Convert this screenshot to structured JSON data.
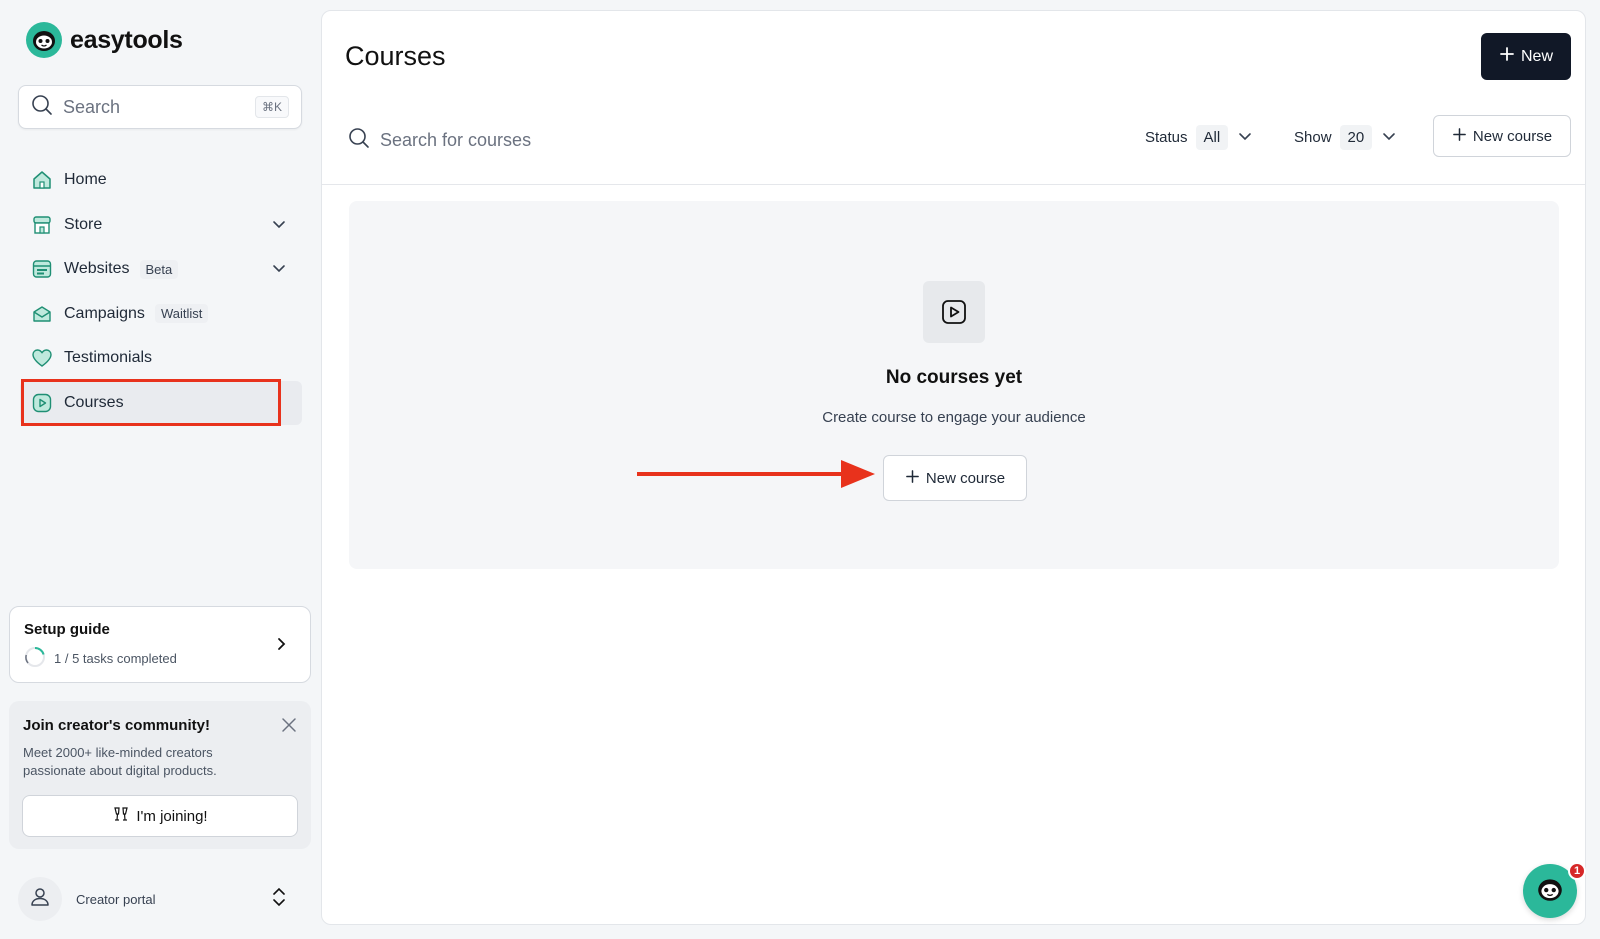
{
  "brand": {
    "name": "easytools"
  },
  "sidebar": {
    "search": {
      "placeholder": "Search",
      "shortcut": "⌘K"
    },
    "items": [
      {
        "label": "Home",
        "icon": "home-icon"
      },
      {
        "label": "Store",
        "icon": "store-icon",
        "expandable": true
      },
      {
        "label": "Websites",
        "icon": "websites-icon",
        "badge": "Beta",
        "expandable": true
      },
      {
        "label": "Campaigns",
        "icon": "campaigns-icon",
        "badge": "Waitlist"
      },
      {
        "label": "Testimonials",
        "icon": "heart-icon"
      },
      {
        "label": "Courses",
        "icon": "play-icon",
        "active": true
      }
    ],
    "setup_guide": {
      "title": "Setup guide",
      "progress": "1 / 5 tasks completed"
    },
    "community": {
      "title": "Join creator's community!",
      "text": "Meet 2000+ like-minded creators passionate about digital products.",
      "button": "I'm joining!"
    },
    "portal": {
      "label": "Creator portal"
    }
  },
  "main": {
    "title": "Courses",
    "new_button": "New",
    "search_placeholder": "Search for courses",
    "filters": {
      "status_label": "Status",
      "status_value": "All",
      "show_label": "Show",
      "show_value": "20"
    },
    "new_course_button": "New course",
    "empty": {
      "title": "No courses yet",
      "subtitle": "Create course to engage your audience",
      "button": "New course"
    }
  },
  "chat": {
    "unread": "1"
  },
  "colors": {
    "accent": "#2bb89a",
    "annotation": "#e8321c",
    "primary_button": "#111827"
  }
}
